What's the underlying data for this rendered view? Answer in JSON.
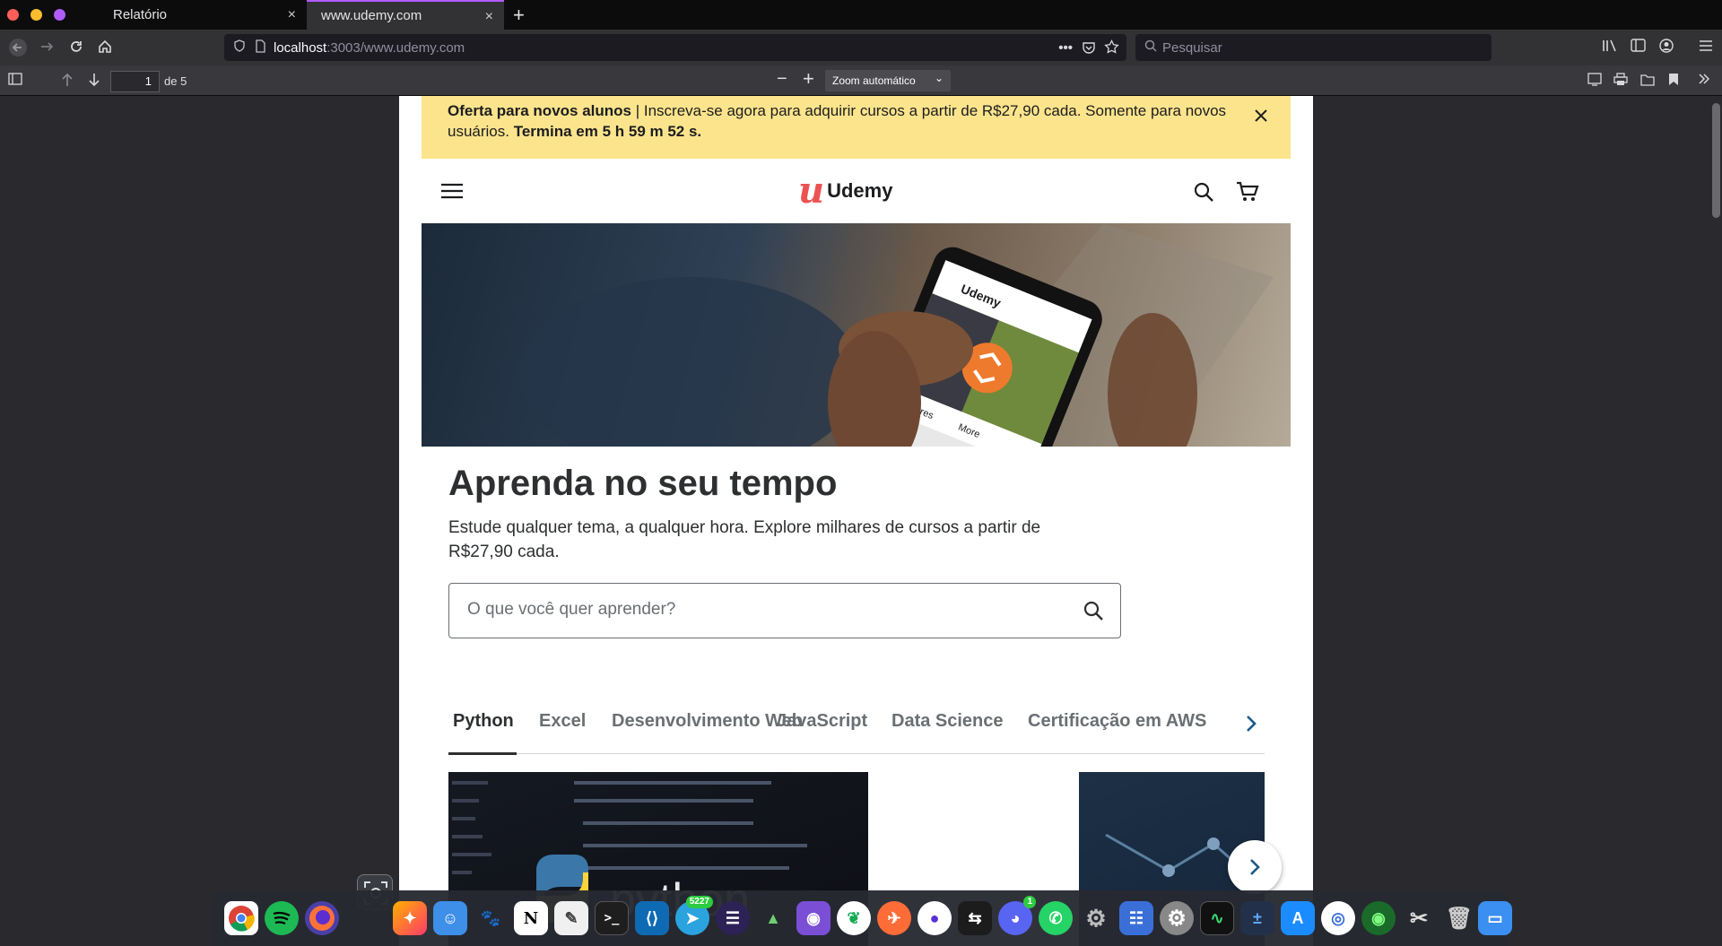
{
  "browser": {
    "tabs": [
      {
        "label": "Relatório",
        "close": "×"
      },
      {
        "label": "www.udemy.com",
        "close": "×"
      }
    ],
    "new_tab": "+",
    "url_host": "localhost",
    "url_rest": ":3003/www.udemy.com",
    "url_more": "•••",
    "search_placeholder": "Pesquisar"
  },
  "pdf_toolbar": {
    "page_current": "1",
    "page_total": "de 5",
    "zoom_out": "−",
    "zoom_in": "+",
    "zoom_label": "Zoom automático",
    "zoom_chevron": "⌄"
  },
  "promo": {
    "bold": "Oferta para novos alunos",
    "text": " | Inscreva-se agora para adquirir cursos a partir de R$27,90 cada. Somente para novos usuários. ",
    "timer": "Termina em 5 h 59 m 52 s."
  },
  "header": {
    "logo_mark": "u",
    "logo_text": "Udemy"
  },
  "hero": {
    "phone_brand": "Udemy",
    "phone_tab1": "Lectures",
    "phone_tab2": "More"
  },
  "main": {
    "title": "Aprenda no seu tempo",
    "subtitle": "Estude qualquer tema, a qualquer hora. Explore milhares de cursos a partir de R$27,90 cada.",
    "search_placeholder": "O que você quer aprender?"
  },
  "course_tabs": [
    {
      "label": "Python"
    },
    {
      "label": "Excel"
    },
    {
      "label": "Desenvolvimento Web"
    },
    {
      "label": "JavaScript"
    },
    {
      "label": "Data Science"
    },
    {
      "label": "Certificação em AWS"
    }
  ],
  "cards": {
    "card1_text": "python"
  },
  "dock": {
    "telegram_badge": "5227",
    "discord_badge": "1"
  },
  "colors": {
    "accent": "#b05cff",
    "promo_bg": "#fce48c",
    "udemy_red": "#ec5252"
  }
}
